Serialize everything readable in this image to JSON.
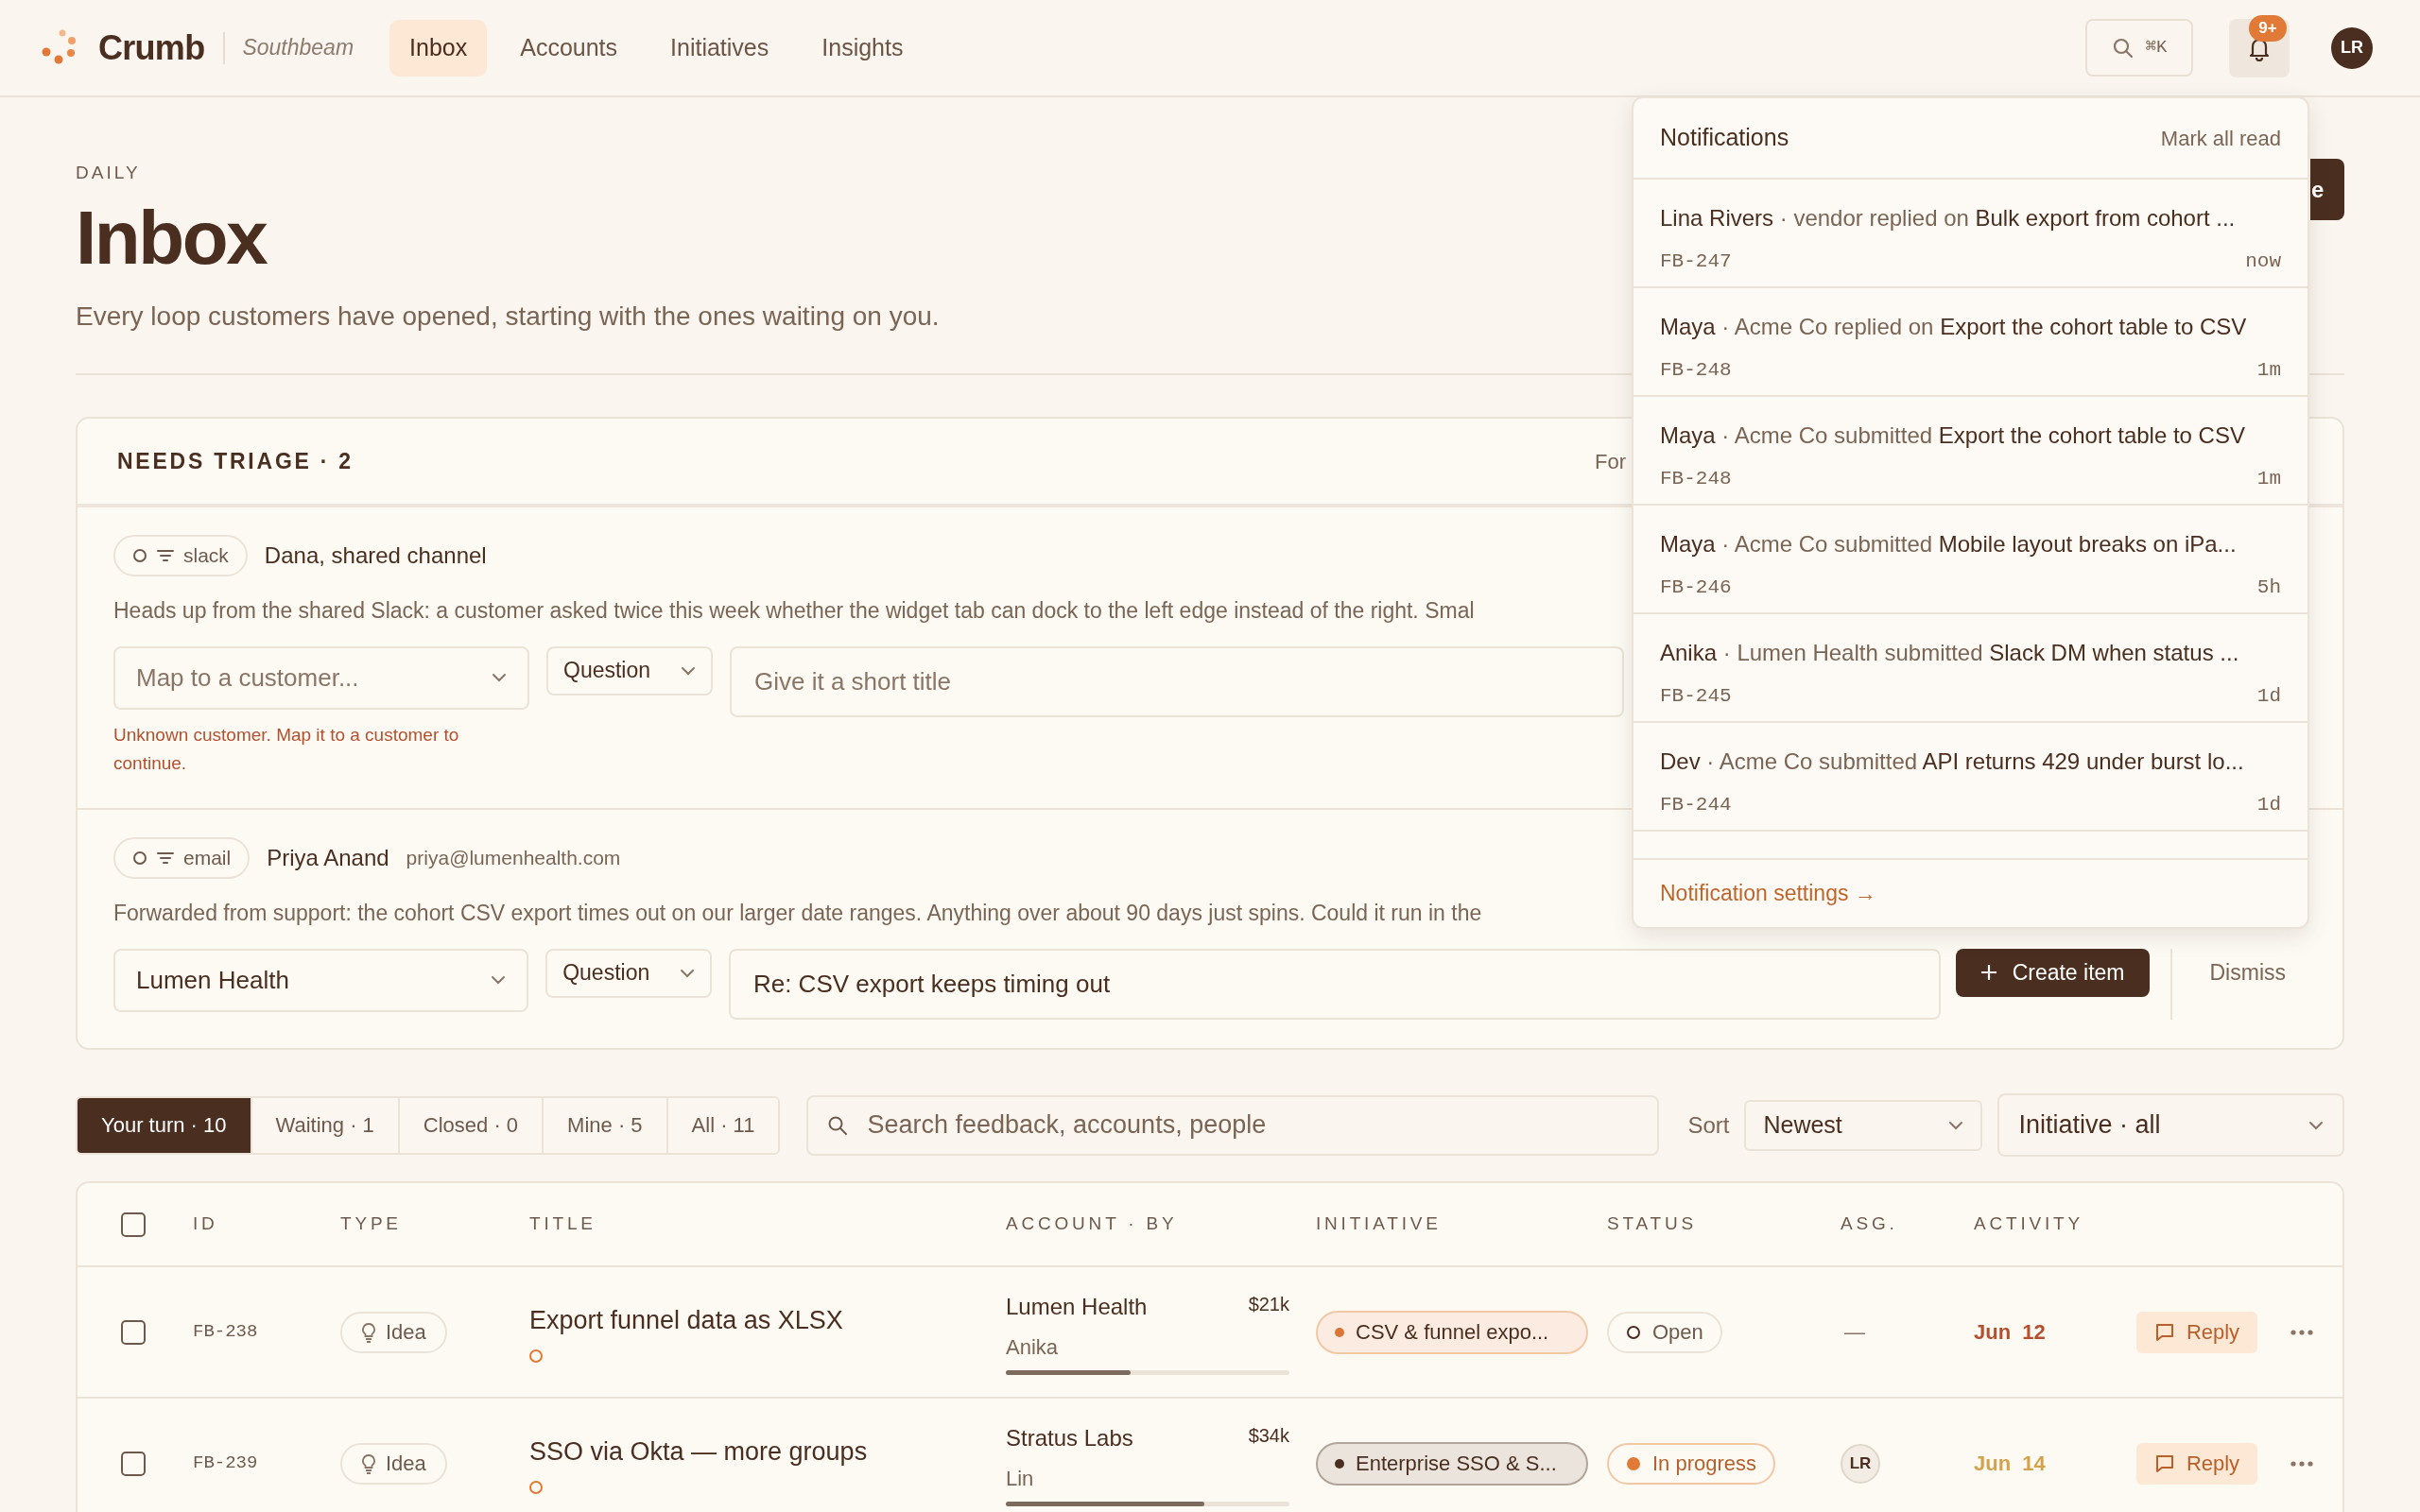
{
  "app": {
    "brand": "Crumb",
    "workspace": "Southbeam"
  },
  "nav": [
    {
      "label": "Inbox",
      "selected": true
    },
    {
      "label": "Accounts",
      "selected": false
    },
    {
      "label": "Initiatives",
      "selected": false
    },
    {
      "label": "Insights",
      "selected": false
    }
  ],
  "search_button": {
    "shortcut": "⌘K"
  },
  "notifications_button": {
    "badge": "9+"
  },
  "avatar": {
    "initials": "LR"
  },
  "page": {
    "eyebrow": "DAILY",
    "title": "Inbox",
    "subtitle": "Every loop customers have opened, starting with the ones waiting on you.",
    "primary_button": "e"
  },
  "triage": {
    "title": "NEEDS TRIAGE · 2",
    "header_right": "For",
    "items": [
      {
        "source": "slack",
        "from": "Dana, shared channel",
        "body": "Heads up from the shared Slack: a customer asked twice this week whether the widget tab can dock to the left edge instead of the right. Smal",
        "customer": {
          "placeholder": "Map to a customer..."
        },
        "type": "Question",
        "title_field": {
          "placeholder": "Give it a short title"
        },
        "error": "Unknown customer. Map it to a customer to continue."
      },
      {
        "source": "email",
        "from": "Priya Anand",
        "email": "priya@lumenhealth.com",
        "body": "Forwarded from support: the cohort CSV export times out on our larger date ranges. Anything over about 90 days just spins. Could it run in the",
        "customer": {
          "value": "Lumen Health"
        },
        "type": "Question",
        "title_field": {
          "value": "Re: CSV export keeps timing out"
        },
        "create_button": "Create item",
        "dismiss_button": "Dismiss"
      }
    ]
  },
  "filters": {
    "tabs": [
      {
        "label": "Your turn · 10",
        "selected": true
      },
      {
        "label": "Waiting · 1",
        "selected": false
      },
      {
        "label": "Closed · 0",
        "selected": false
      },
      {
        "label": "Mine · 5",
        "selected": false
      },
      {
        "label": "All · 11",
        "selected": false
      }
    ],
    "search": {
      "placeholder": "Search feedback, accounts, people"
    },
    "sort_label": "Sort",
    "sort": "Newest",
    "initiative": "Initiative · all"
  },
  "table": {
    "select_all": {
      "checked": false
    },
    "columns": [
      "ID",
      "TYPE",
      "TITLE",
      "ACCOUNT · BY",
      "INITIATIVE",
      "STATUS",
      "ASG.",
      "ACTIVITY"
    ],
    "rows": [
      {
        "checked": false,
        "id": "FB-238",
        "type": "Idea",
        "title": "Export funnel data as XLSX",
        "unread": true,
        "account": "Lumen Health",
        "by": "Anika",
        "value": "$21k",
        "level": 0.44,
        "initiative": {
          "label": "CSV & funnel expo...",
          "color": "#d9773a"
        },
        "status": {
          "kind": "open",
          "label": "Open"
        },
        "assignee": {
          "kind": "none",
          "text": "—"
        },
        "activity": {
          "text": "Jun  12",
          "color": "#b5502f"
        },
        "reply": "Reply"
      },
      {
        "checked": false,
        "id": "FB-239",
        "type": "Idea",
        "title": "SSO via Okta — more groups",
        "unread": true,
        "account": "Stratus Labs",
        "by": "Lin",
        "value": "$34k",
        "level": 0.7,
        "initiative": {
          "label": "Enterprise SSO & S...",
          "color": "#4a2e20"
        },
        "status": {
          "kind": "in_progress",
          "label": "In progress"
        },
        "assignee": {
          "kind": "person",
          "text": "LR"
        },
        "activity": {
          "text": "Jun  14",
          "color": "#d4a24c"
        },
        "reply": "Reply"
      }
    ]
  },
  "notification_panel": {
    "title": "Notifications",
    "mark_all": "Mark all read",
    "items": [
      {
        "actor": "Lina Rivers",
        "action": "· vendor replied on",
        "subject": "Bulk export from cohort ...",
        "id": "FB-247",
        "time": "now"
      },
      {
        "actor": "Maya",
        "action": "· Acme Co replied on",
        "subject": "Export the cohort table to CSV",
        "id": "FB-248",
        "time": "1m"
      },
      {
        "actor": "Maya",
        "action": "· Acme Co submitted",
        "subject": "Export the cohort table to CSV",
        "id": "FB-248",
        "time": "1m"
      },
      {
        "actor": "Maya",
        "action": "· Acme Co submitted",
        "subject": "Mobile layout breaks on iPa...",
        "id": "FB-246",
        "time": "5h"
      },
      {
        "actor": "Anika",
        "action": "· Lumen Health submitted",
        "subject": "Slack DM when status ...",
        "id": "FB-245",
        "time": "1d"
      },
      {
        "actor": "Dev",
        "action": "· Acme Co submitted",
        "subject": "API returns 429 under burst lo...",
        "id": "FB-244",
        "time": "1d"
      }
    ],
    "settings_link": "Notification settings →"
  }
}
